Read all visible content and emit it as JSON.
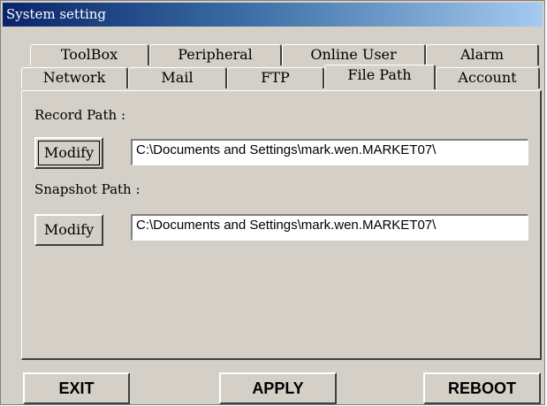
{
  "window": {
    "title": "System setting"
  },
  "tabs": {
    "row1": [
      "ToolBox",
      "Peripheral",
      "Online User",
      "Alarm"
    ],
    "row2": [
      "Network",
      "Mail",
      "FTP",
      "File Path",
      "Account"
    ],
    "active": "File Path"
  },
  "file_path": {
    "record_label": "Record Path :",
    "record_modify": "Modify",
    "record_value": "C:\\Documents and Settings\\mark.wen.MARKET07\\",
    "snapshot_label": "Snapshot Path :",
    "snapshot_modify": "Modify",
    "snapshot_value": "C:\\Documents and Settings\\mark.wen.MARKET07\\"
  },
  "footer": {
    "exit": "EXIT",
    "apply": "APPLY",
    "reboot": "REBOOT"
  }
}
